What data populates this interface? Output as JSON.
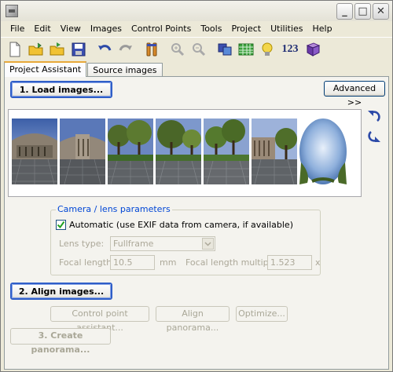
{
  "window": {
    "title": "",
    "controls": [
      "minimize",
      "maximize",
      "close"
    ]
  },
  "menu": [
    "File",
    "Edit",
    "View",
    "Images",
    "Control Points",
    "Tools",
    "Project",
    "Utilities",
    "Help"
  ],
  "toolbar": {
    "icons": [
      "new-document-icon",
      "open-folder-icon",
      "open-folder-arrow-icon",
      "save-icon",
      "undo-icon",
      "redo-icon",
      "optimize-tool-icon",
      "zoom-in-icon",
      "zoom-out-icon",
      "preview-panorama-icon",
      "table-icon",
      "lightbulb-icon",
      "numbers-icon",
      "help-book-icon"
    ],
    "numbers_label": "123"
  },
  "tabs": [
    {
      "label": "Project Assistant",
      "active": true
    },
    {
      "label": "Source images",
      "active": false
    }
  ],
  "assistant": {
    "load_images_label": "1. Load images...",
    "advanced_label": "Advanced >>",
    "thumbnails": [
      "building-1",
      "building-2",
      "courtyard-1",
      "courtyard-2",
      "courtyard-3",
      "building-3",
      "sky-zenith"
    ],
    "camera_group": {
      "title": "Camera / lens parameters",
      "automatic_label": "Automatic (use EXIF data from camera, if available)",
      "automatic_checked": true,
      "lens_type_label": "Lens type:",
      "lens_type_value": "Fullframe",
      "focal_length_label": "Focal length:",
      "focal_length_value": "10.5",
      "focal_length_unit": "mm",
      "multiplier_label": "Focal length multiplier:",
      "multiplier_value": "1.523",
      "multiplier_unit": "x"
    },
    "align_images_label": "2. Align images...",
    "control_point_label": "Control point assistant...",
    "align_panorama_label": "Align panorama...",
    "optimize_label": "Optimize...",
    "create_panorama_label": "3. Create panorama..."
  },
  "colors": {
    "accent_blue": "#2f5ec8",
    "group_title": "#0046d5",
    "tab_highlight": "#e8a93a"
  }
}
